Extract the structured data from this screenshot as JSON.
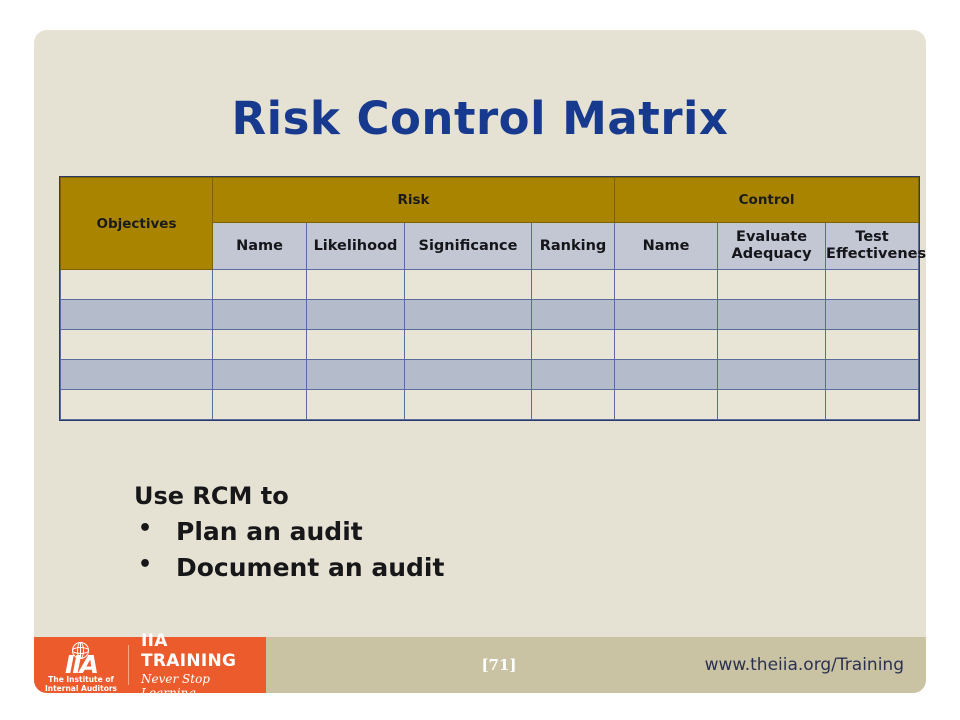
{
  "slide": {
    "title": "Risk Control Matrix",
    "background_color": "#E6E2D3",
    "title_color": "#173A8E"
  },
  "table": {
    "group_headers": [
      {
        "label": "Objectives",
        "span": 1
      },
      {
        "label": "Risk",
        "span": 4
      },
      {
        "label": "Control",
        "span": 3
      }
    ],
    "sub_headers": [
      "Name",
      "Likelihood",
      "Significance",
      "Ranking",
      "Name",
      "Evaluate Adequacy",
      "Test Effectiveness"
    ],
    "body_row_count": 5,
    "column_count": 8,
    "header_color": "#A88400",
    "subheader_color": "#C2C7D3",
    "row_color_odd": "#E9E5D6",
    "row_color_even": "#B4BCCC",
    "border_color": "#5A6B9E",
    "cells": [
      [
        "",
        "",
        "",
        "",
        "",
        "",
        "",
        ""
      ],
      [
        "",
        "",
        "",
        "",
        "",
        "",
        "",
        ""
      ],
      [
        "",
        "",
        "",
        "",
        "",
        "",
        "",
        ""
      ],
      [
        "",
        "",
        "",
        "",
        "",
        "",
        "",
        ""
      ],
      [
        "",
        "",
        "",
        "",
        "",
        "",
        "",
        ""
      ]
    ]
  },
  "content": {
    "lead": "Use RCM to",
    "bullets": [
      "Plan an audit",
      "Document an audit"
    ]
  },
  "footer": {
    "logo": {
      "mark_letters": "IIA",
      "mark_subtitle_line1": "The Institute of",
      "mark_subtitle_line2": "Internal Auditors",
      "training_title": "IIA TRAINING",
      "training_tagline": "Never Stop Learning",
      "brand_color": "#EC5B2B"
    },
    "page_number": "[71]",
    "url": "www.theiia.org/Training",
    "bar_color": "#C9C3A4"
  }
}
